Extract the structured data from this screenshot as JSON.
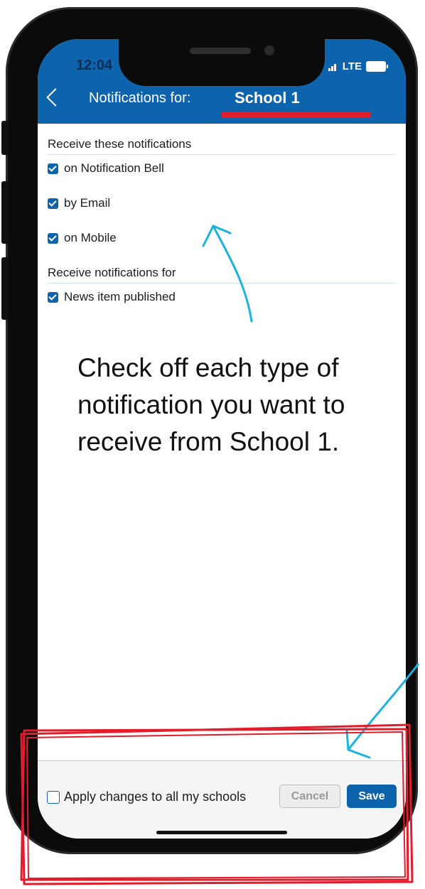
{
  "status_bar": {
    "time": "12:04",
    "network": "LTE"
  },
  "header": {
    "label": "Notifications for:",
    "school": "School 1",
    "back_icon": "chevron-left-icon"
  },
  "sections": [
    {
      "heading": "Receive these notifications",
      "items": [
        {
          "label": "on Notification Bell",
          "checked": true
        },
        {
          "label": "by Email",
          "checked": true
        },
        {
          "label": "on Mobile",
          "checked": true
        }
      ]
    },
    {
      "heading": "Receive notifications for",
      "items": [
        {
          "label": "News item published",
          "checked": true
        }
      ]
    }
  ],
  "annotation": {
    "text": "Check off each type of notification you want to receive from School 1."
  },
  "footer": {
    "apply_all_label": "Apply changes to all my schools",
    "apply_all_checked": false,
    "cancel_label": "Cancel",
    "save_label": "Save"
  },
  "colors": {
    "header_bg": "#0e63ad",
    "highlight_red": "#e21d2b",
    "arrow_blue": "#1ab3dc"
  }
}
